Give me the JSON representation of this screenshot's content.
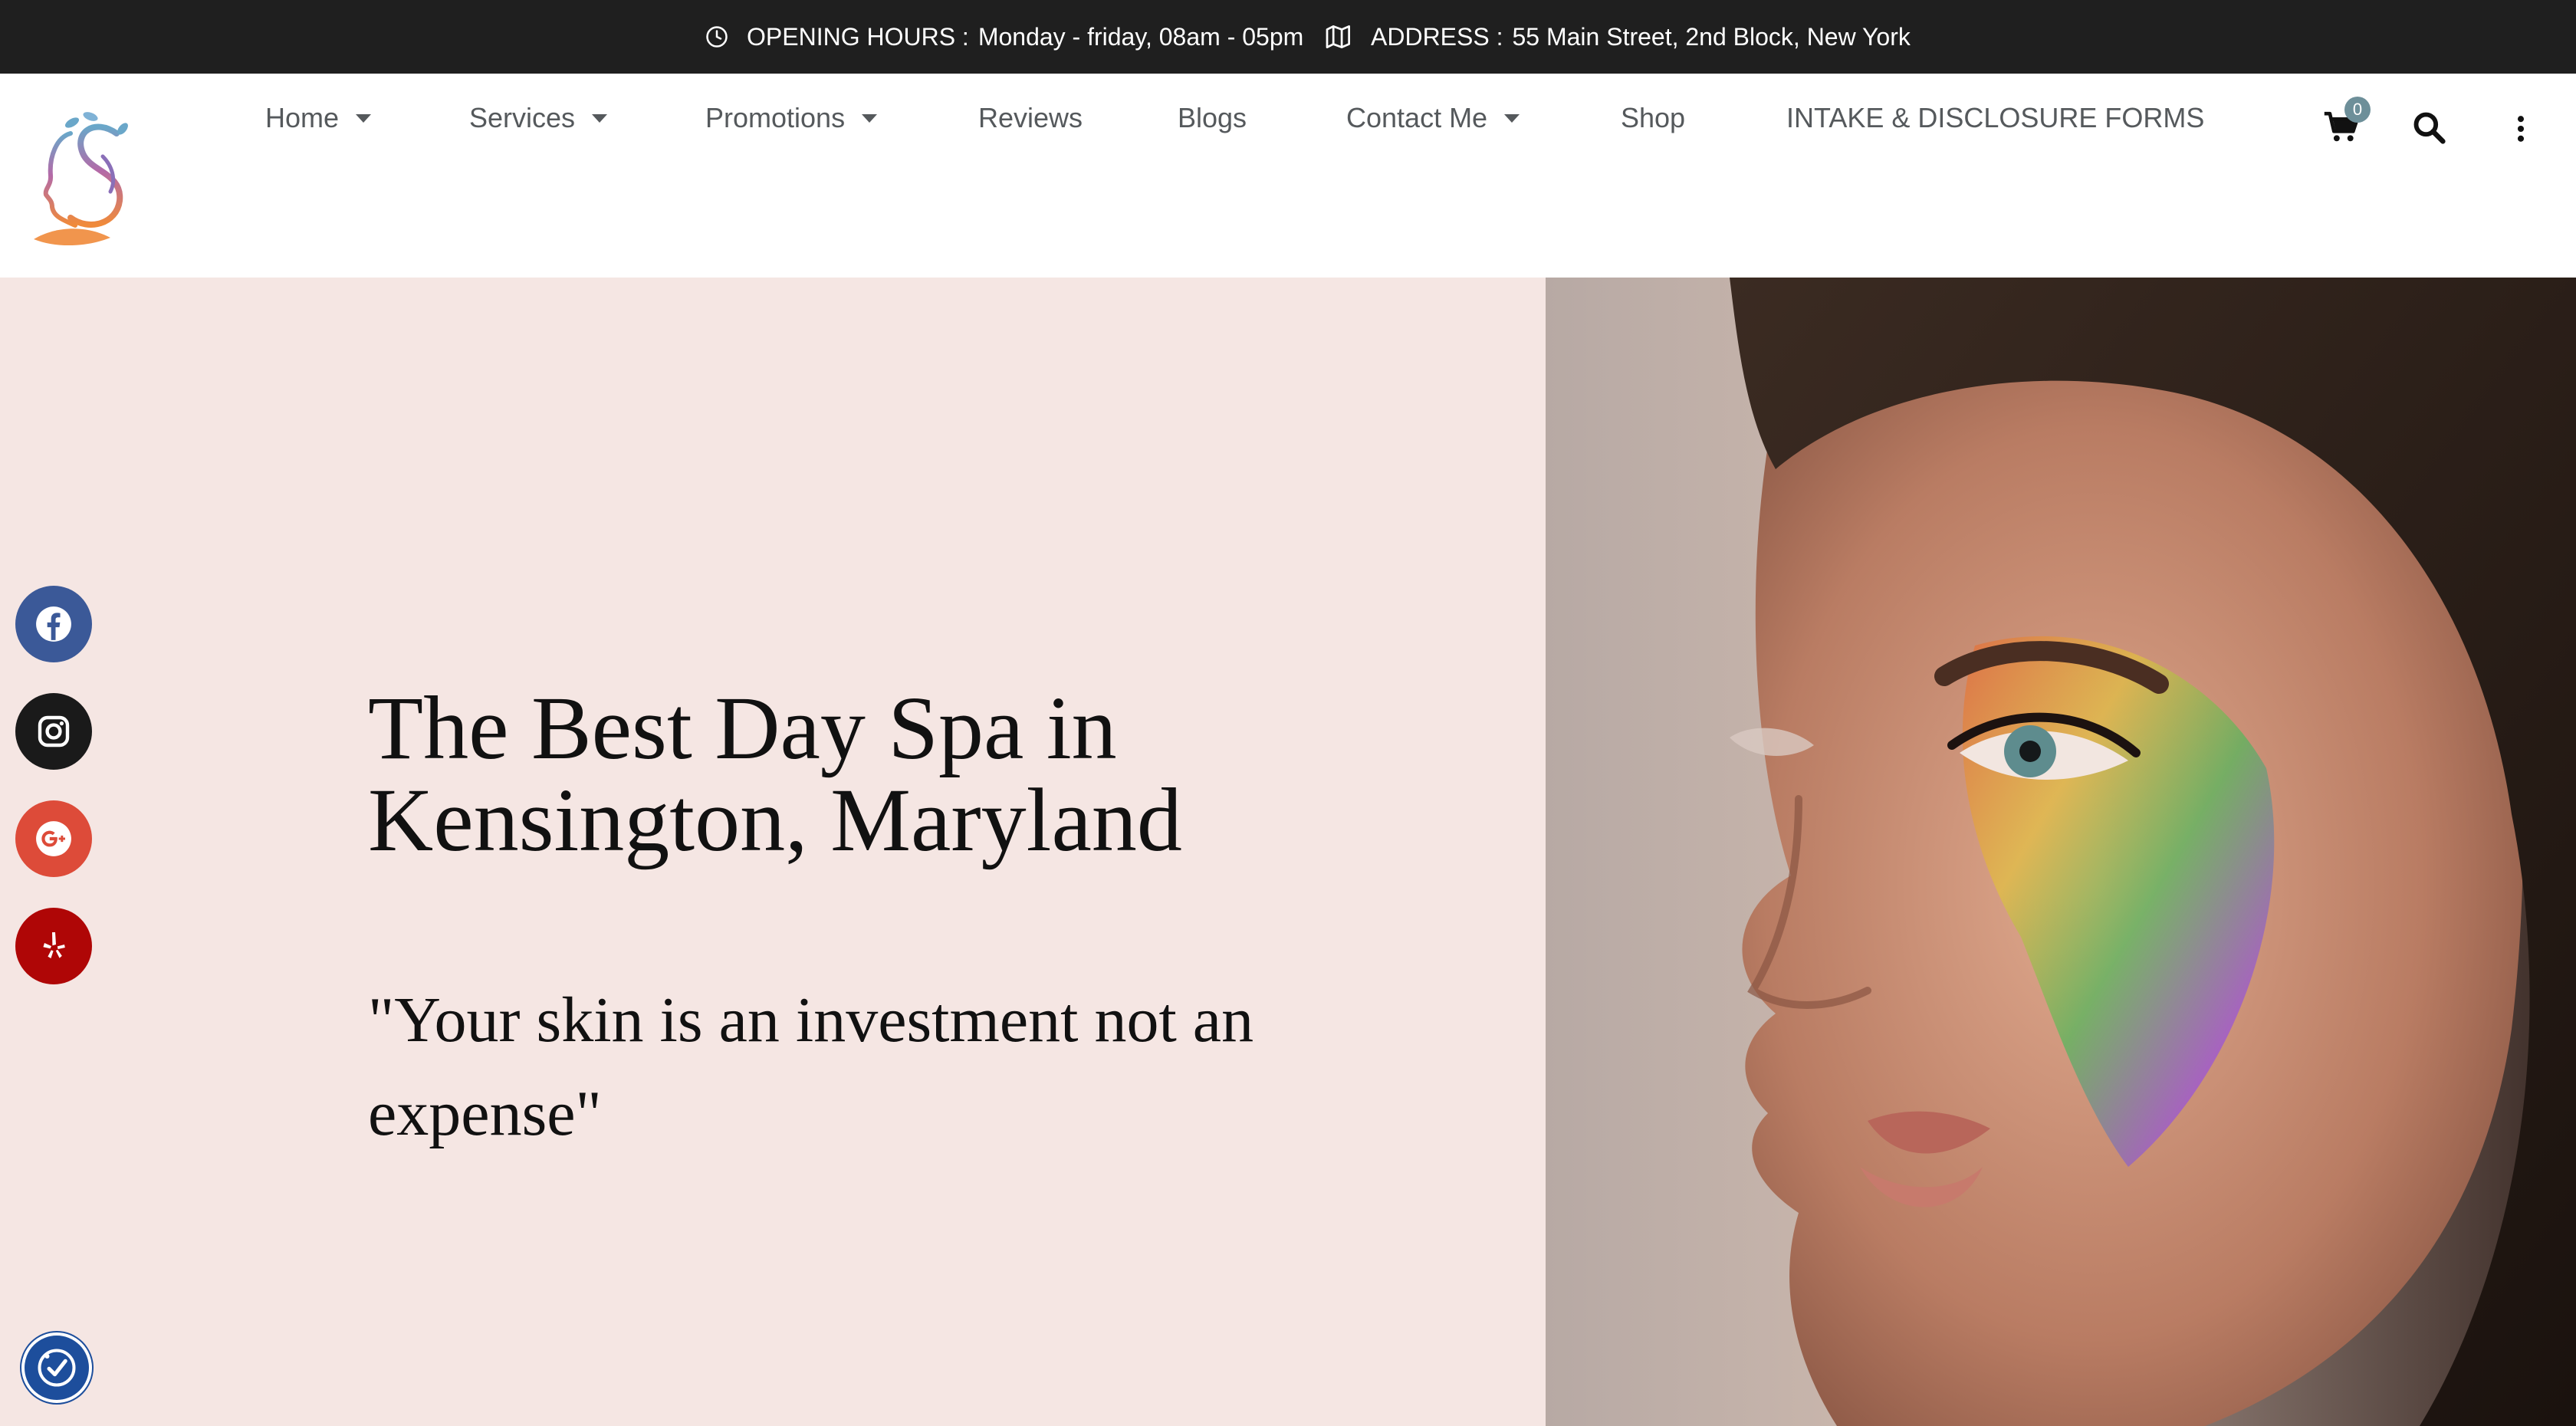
{
  "topbar": {
    "hours_label": "OPENING HOURS :",
    "hours_value": "Monday - friday, 08am - 05pm",
    "address_label": "ADDRESS :",
    "address_value": "55 Main Street, 2nd Block, New York",
    "icons": [
      "clock-icon",
      "map-icon"
    ]
  },
  "nav": {
    "items": [
      {
        "label": "Home",
        "has_dropdown": true
      },
      {
        "label": "Services",
        "has_dropdown": true
      },
      {
        "label": "Promotions",
        "has_dropdown": true
      },
      {
        "label": "Reviews",
        "has_dropdown": false
      },
      {
        "label": "Blogs",
        "has_dropdown": false
      },
      {
        "label": "Contact Me",
        "has_dropdown": true
      },
      {
        "label": "Shop",
        "has_dropdown": false
      },
      {
        "label": "INTAKE & DISCLOSURE FORMS",
        "has_dropdown": false
      }
    ],
    "cart_count": "0",
    "icons": [
      "cart-icon",
      "search-icon",
      "more-vertical-icon"
    ]
  },
  "hero": {
    "title": "The Best Day Spa in Kensington, Maryland",
    "quote": "\"Your skin is an investment not an expense\""
  },
  "social": [
    {
      "name": "facebook-icon",
      "color": "#3b5998"
    },
    {
      "name": "instagram-icon",
      "color": "#1a1a1a"
    },
    {
      "name": "google-plus-icon",
      "color": "#dd4b39"
    },
    {
      "name": "yelp-icon",
      "color": "#af0606"
    }
  ],
  "colors": {
    "topbar_bg": "#1f1f1f",
    "hero_bg": "#f5e6e3",
    "nav_text": "#55595c",
    "cart_badge": "#6d8f99",
    "accessibility_button": "#1d4e9c"
  },
  "accessibility_icon": "accessibility-icon"
}
